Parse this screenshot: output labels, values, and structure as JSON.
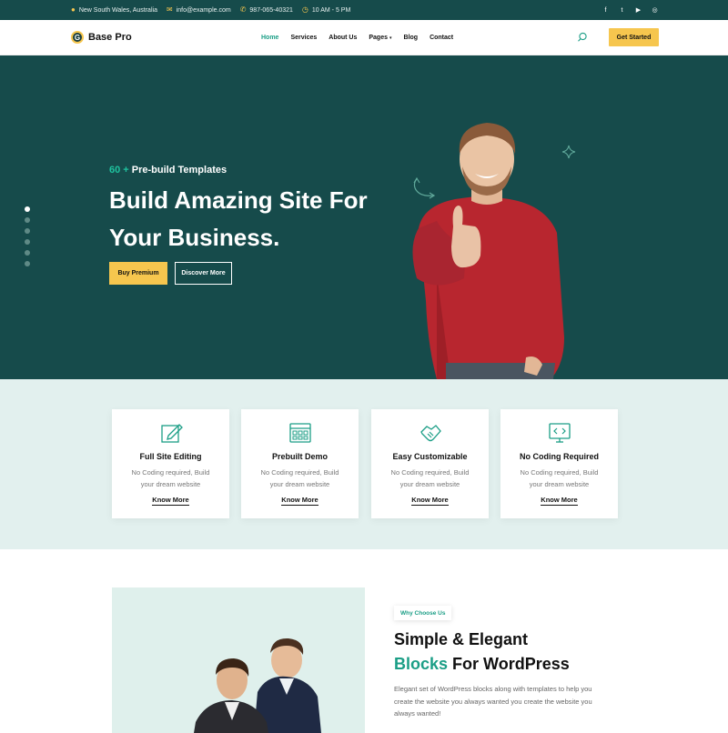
{
  "topbar": {
    "location": "New South Wales, Australia",
    "email": "info@example.com",
    "phone": "987-065-40321",
    "hours": "10 AM - 5 PM",
    "social": [
      "facebook-icon",
      "twitter-icon",
      "youtube-icon",
      "instagram-icon"
    ]
  },
  "nav": {
    "logo_letter": "G",
    "logo_text": "Base Pro",
    "items": [
      {
        "label": "Home",
        "active": true
      },
      {
        "label": "Services"
      },
      {
        "label": "About Us"
      },
      {
        "label": "Pages",
        "dropdown": true
      },
      {
        "label": "Blog"
      },
      {
        "label": "Contact"
      }
    ],
    "cta": "Get Started"
  },
  "hero": {
    "count": "60 +",
    "subtitle": "Pre-build Templates",
    "title_line1": "Build Amazing Site For",
    "title_line2": "Your Business.",
    "btn_primary": "Buy Premium",
    "btn_secondary": "Discover More",
    "slides": 6,
    "active_slide": 1
  },
  "features": [
    {
      "title": "Full Site Editing",
      "desc1": "No Coding required, Build",
      "desc2": "your dream website",
      "link": "Know More",
      "icon": "edit-icon"
    },
    {
      "title": "Prebuilt Demo",
      "desc1": "No Coding required, Build",
      "desc2": "your dream website",
      "link": "Know More",
      "icon": "grid-demo-icon"
    },
    {
      "title": "Easy Customizable",
      "desc1": "No Coding required, Build",
      "desc2": "your dream website",
      "link": "Know More",
      "icon": "handshake-icon"
    },
    {
      "title": "No Coding Required",
      "desc1": "No Coding required, Build",
      "desc2": "your dream website",
      "link": "Know More",
      "icon": "code-monitor-icon"
    }
  ],
  "why": {
    "badge": "Why Choose Us",
    "title_line1": "Simple & Elegant",
    "title_green": "Blocks",
    "title_rest": " For WordPress",
    "text": "Elegant set of WordPress blocks along with templates to help you create the website you always wanted you create the website you always wanted!"
  },
  "colors": {
    "primary": "#164b4b",
    "accent": "#f6c64e",
    "green": "#1b9e86",
    "light": "#e2f0ee"
  }
}
